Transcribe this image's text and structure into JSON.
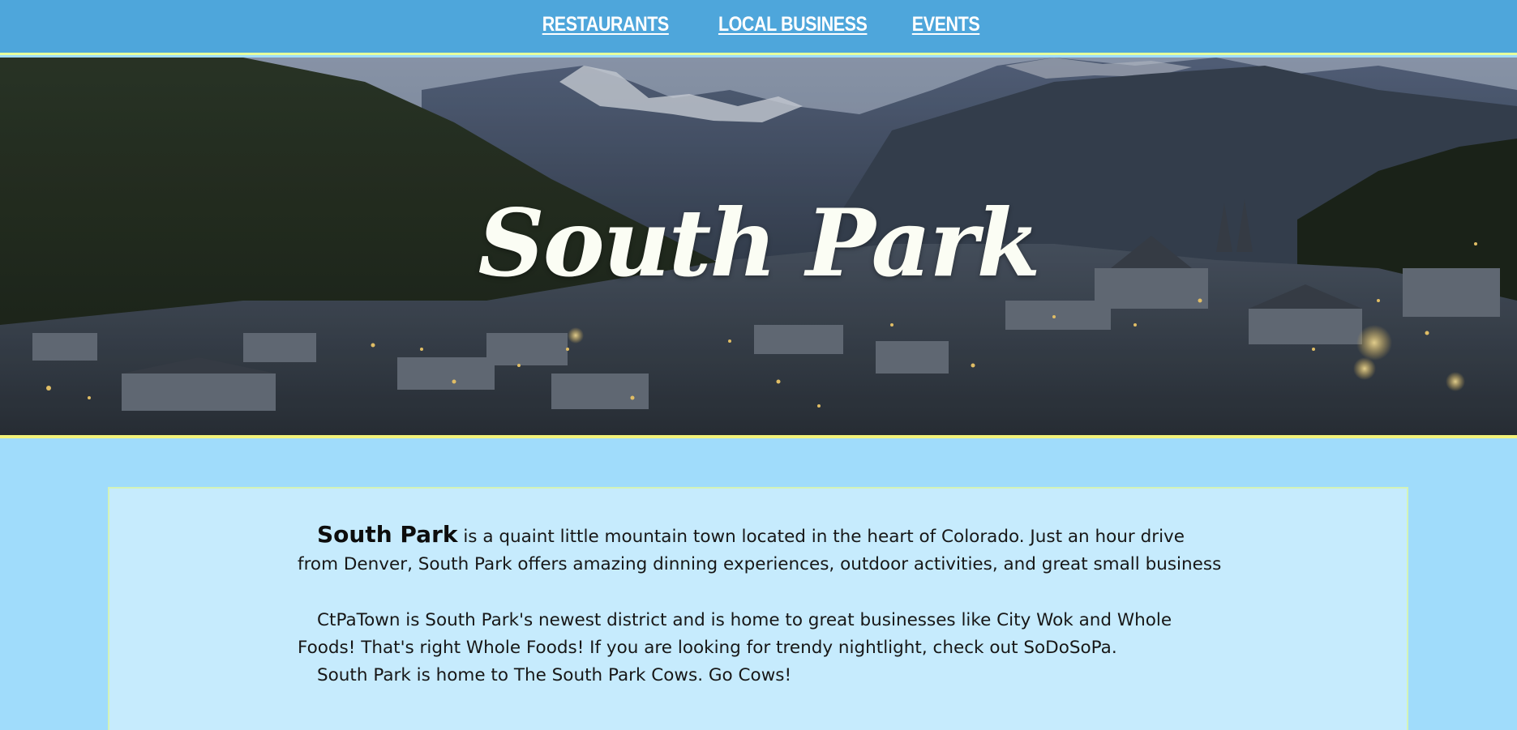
{
  "nav": {
    "items": [
      {
        "label": "RESTAURANTS"
      },
      {
        "label": "LOCAL BUSINESS"
      },
      {
        "label": "EVENTS"
      }
    ]
  },
  "hero": {
    "title": "South Park"
  },
  "content": {
    "intro": {
      "lead": "South Park",
      "text": " is a quaint little mountain town located in the heart of Colorado. Just an hour drive from Denver, South Park offers amazing dinning experiences, outdoor activities, and great small business"
    },
    "paragraph_2": "CtPaTown is South Park's newest district and is home to great businesses like City Wok and Whole Foods! That's right Whole Foods! If you are looking for trendy nightlight, check out SoDoSoPa.",
    "paragraph_3": "South Park is home to The South Park Cows. Go Cows!"
  },
  "colors": {
    "nav_bg": "#4ea6db",
    "page_bg": "#a0dcfb",
    "card_bg": "#c6ebfd",
    "accent_border": "#f3f27a"
  }
}
